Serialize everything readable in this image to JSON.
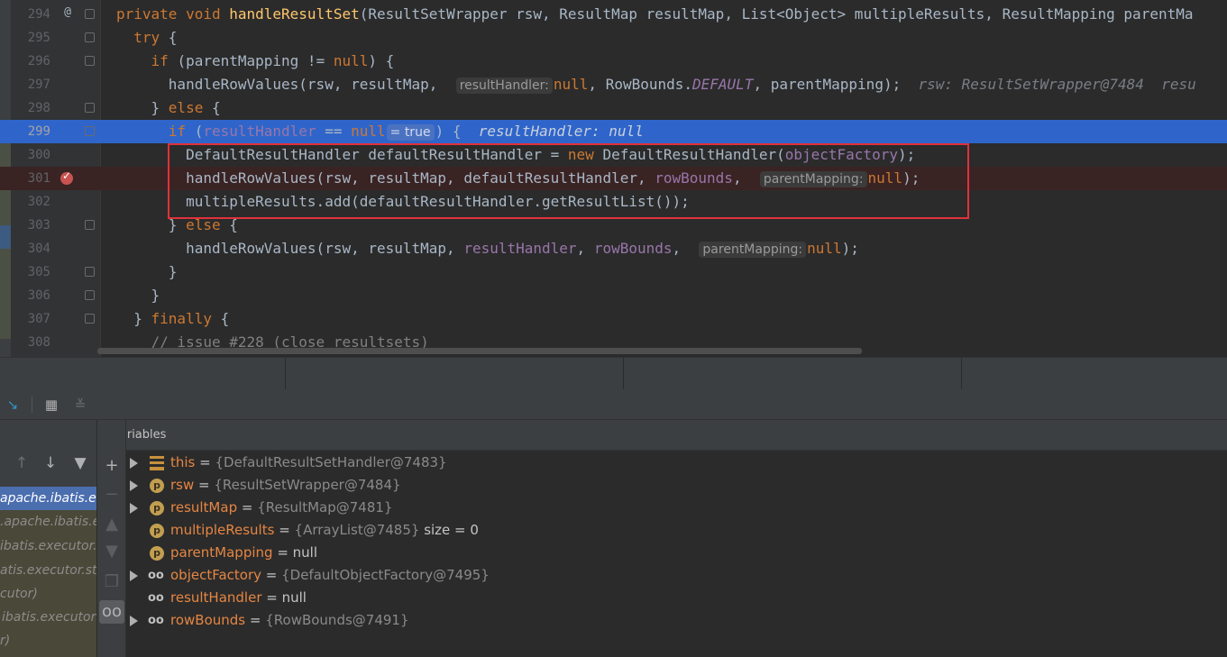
{
  "editor": {
    "lines": [
      {
        "n": "294",
        "mark": "@"
      },
      {
        "n": "295"
      },
      {
        "n": "296"
      },
      {
        "n": "297"
      },
      {
        "n": "298"
      },
      {
        "n": "299"
      },
      {
        "n": "300"
      },
      {
        "n": "301"
      },
      {
        "n": "302"
      },
      {
        "n": "303"
      },
      {
        "n": "304"
      },
      {
        "n": "305"
      },
      {
        "n": "306"
      },
      {
        "n": "307"
      },
      {
        "n": "308"
      }
    ],
    "hints": {
      "result_handler": "resultHandler:",
      "true_val": "= true",
      "parent_mapping": "parentMapping:"
    },
    "inline_values": {
      "l297": "rsw: ResultSetWrapper@7484  resu",
      "l299": "resultHandler: null"
    }
  },
  "variables": {
    "title": "Variables",
    "rows": [
      {
        "name": "this",
        "eq": " = ",
        "value": "{DefaultResultSetHandler@7483}",
        "icon": "list",
        "expandable": true
      },
      {
        "name": "rsw",
        "eq": " = ",
        "value": "{ResultSetWrapper@7484}",
        "icon": "p",
        "expandable": true
      },
      {
        "name": "resultMap",
        "eq": " = ",
        "value": "{ResultMap@7481}",
        "icon": "p",
        "expandable": true
      },
      {
        "name": "multipleResults",
        "eq": " = ",
        "value": "{ArrayList@7485}",
        "extra": "  size = 0",
        "icon": "p",
        "expandable": false
      },
      {
        "name": "parentMapping",
        "eq": " = ",
        "value": "null",
        "icon": "p",
        "expandable": false,
        "plain": true
      },
      {
        "name": "objectFactory",
        "eq": " = ",
        "value": "{DefaultObjectFactory@7495}",
        "icon": "watch",
        "expandable": true
      },
      {
        "name": "resultHandler",
        "eq": " = ",
        "value": "null",
        "icon": "watch",
        "expandable": false,
        "plain": true
      },
      {
        "name": "rowBounds",
        "eq": " = ",
        "value": "{RowBounds@7491}",
        "icon": "watch",
        "expandable": true
      }
    ]
  },
  "frames": {
    "items": [
      "apache.ibatis.e",
      ".apache.ibatis.e",
      "ibatis.executor.s",
      "atis.executor.st",
      "cutor)",
      "ibatis.executor",
      "r)"
    ]
  },
  "icons": {
    "param": "p",
    "watch": "oo"
  }
}
